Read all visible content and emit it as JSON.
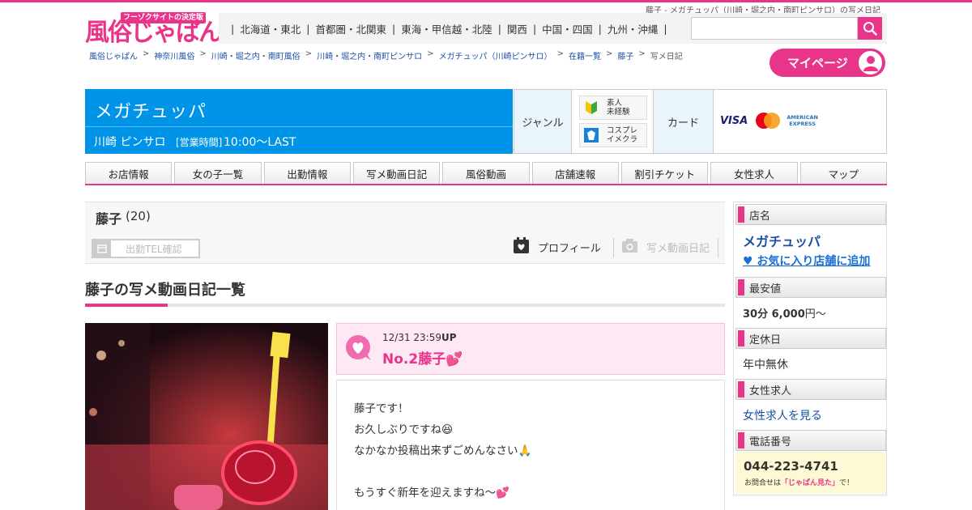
{
  "header": {
    "page_caption": "藤子 - メガチュッパ（川崎・堀之内・南町ピンサロ）の写メ日記",
    "logo_tagline": "フーゾクサイトの決定版",
    "logo_text": "風俗じゃぱん!",
    "regions": [
      "北海道・東北",
      "首都圏・北関東",
      "東海・甲信越・北陸",
      "関西",
      "中国・四国",
      "九州・沖縄"
    ],
    "search_placeholder": "",
    "mypage_label": "マイページ"
  },
  "breadcrumb": [
    "風俗じゃぱん",
    "神奈川風俗",
    "川崎・堀之内・南町風俗",
    "川崎・堀之内・南町ピンサロ",
    "メガチュッパ（川崎ピンサロ）",
    "在籍一覧",
    "藤子",
    "写メ日記"
  ],
  "shop": {
    "name": "メガチュッパ",
    "area": "川崎 ピンサロ",
    "hours_label": "[営業時間]",
    "hours": "10:00～LAST",
    "genre_label": "ジャンル",
    "genre_tags": [
      {
        "line1": "素人",
        "line2": "未経験"
      },
      {
        "line1": "コスプレ",
        "line2": "イメクラ"
      }
    ],
    "card_label": "カード",
    "cards": {
      "visa": "VISA",
      "amex_line1": "AMERICAN",
      "amex_line2": "EXPRESS"
    }
  },
  "tabs": [
    "お店情報",
    "女の子一覧",
    "出勤情報",
    "写メ動画日記",
    "風俗動画",
    "店舗速報",
    "割引チケット",
    "女性求人",
    "マップ"
  ],
  "girl": {
    "name": "藤子",
    "age": "(20)",
    "tel_button": "出勤TEL確認",
    "profile_link": "プロフィール",
    "diary_link": "写メ動画日記"
  },
  "section_title": "藤子の写メ動画日記一覧",
  "post": {
    "date": "12/31  23:59",
    "up": "UP",
    "title": "No.2藤子💕",
    "lines": [
      "藤子です！",
      "お久しぶりですね😆",
      "なかなか投稿出来ずごめんなさい🙏",
      "",
      "もうすぐ新年を迎えますね〜💕"
    ]
  },
  "sidebar": {
    "shop_name_head": "店名",
    "shop_name": "メガチュッパ",
    "favorite_link": "♥ お気に入り店舗に追加",
    "min_price_head": "最安値",
    "min_price": "30分 6,000",
    "min_price_suffix": "円～",
    "holiday_head": "定休日",
    "holiday": "年中無休",
    "recruit_head": "女性求人",
    "recruit_link": "女性求人を見る",
    "phone_head": "電話番号",
    "phone": "044-223-4741",
    "phone_note_pre": "お問合せは",
    "phone_note_key": "「じゃぱん見た」",
    "phone_note_post": "で！"
  },
  "colors": {
    "brand_pink": "#e8358a",
    "shop_blue": "#0094e8",
    "link_blue": "#1a4fa5"
  }
}
